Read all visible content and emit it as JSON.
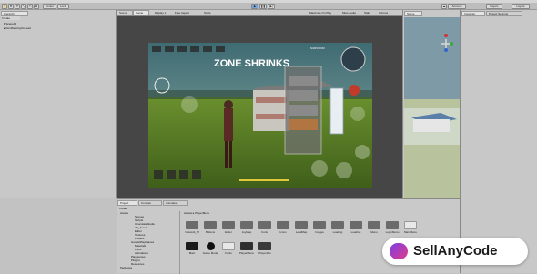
{
  "toolbar": {
    "center": "Center",
    "local": "Local",
    "account": "Account",
    "layers": "Layers",
    "layout": "Layout"
  },
  "hierarchy": {
    "tab": "Hierarchy",
    "create": "Create",
    "items": [
      "Scene02",
      "DontDestroyOnLoad"
    ]
  },
  "game": {
    "tab_scene": "Scene",
    "tab_game": "Game",
    "display": "Display 1",
    "aspect": "Free Aspect",
    "scale": "Scale",
    "maximize": "Maximize On Play",
    "mute": "Mute Audio",
    "stats": "Stats",
    "gizmos": "Gizmos",
    "banner": "ZONE SHRINKS",
    "hud_badge": "SURVIVOR"
  },
  "scene": {
    "tab": "Scene"
  },
  "inspector": {
    "tab": "Inspector",
    "tab2": "Project Settings"
  },
  "project": {
    "tab_project": "Project",
    "tab_console": "Console",
    "tab_animation": "Animation",
    "create": "Create",
    "breadcrumb_root": "Assets",
    "breadcrumb_child": "PlayerMenu",
    "folders": [
      "Animations",
      "Buttons",
      "Editor",
      "Fonts",
      "Icons",
      "Login",
      "LoadingTime",
      "Materials",
      "Music",
      "Prefabs",
      "Scenes",
      "Scripts",
      "Shaders",
      "Sounds",
      "Textures",
      "UI"
    ],
    "tree": [
      "Assets",
      "Scenes",
      "Scripts",
      "ChocolateStudio",
      "2D_Assets",
      "Editor",
      "Textures",
      "Prefabs",
      "GooglePlayGames",
      "Materials",
      "Fonts",
      "Animations",
      "PlayGames",
      "Plugins",
      "Resources",
      "Packages"
    ],
    "assets_row1": [
      "Network_M",
      "Buttons",
      "Editor",
      "JoyMap",
      "Fonts",
      "Icons",
      "LoadMap",
      "Images",
      "Loading",
      "Loading",
      "Menu",
      "LoginMenu",
      "MainMenu"
    ],
    "assets_row2": [
      "Main",
      "Game Mode",
      "Fonts",
      "PlayerMenu",
      "PlayerInfo"
    ]
  },
  "watermark": "SellAnyCode"
}
